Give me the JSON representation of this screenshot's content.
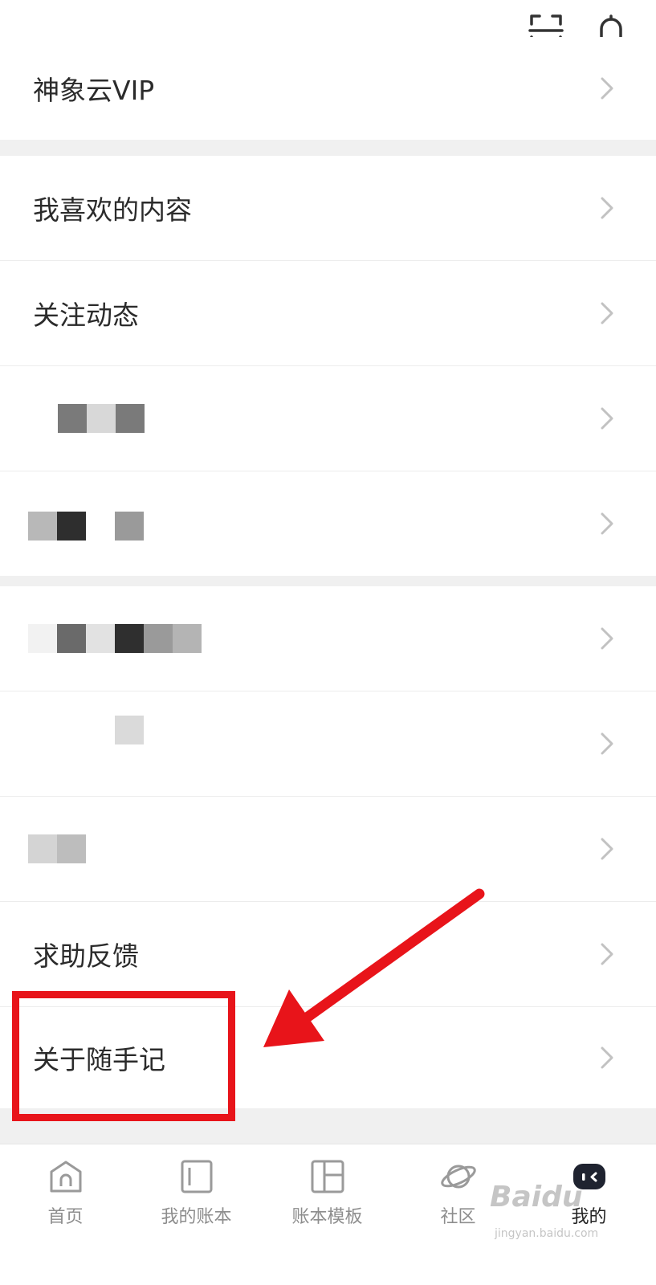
{
  "menu": {
    "vip": "神象云VIP",
    "liked": "我喜欢的内容",
    "follow": "关注动态",
    "help": "求助反馈",
    "about": "关于随手记"
  },
  "tabs": [
    {
      "label": "首页",
      "icon": "home-icon"
    },
    {
      "label": "我的账本",
      "icon": "ledger-icon"
    },
    {
      "label": "账本模板",
      "icon": "template-icon"
    },
    {
      "label": "社区",
      "icon": "planet-icon"
    },
    {
      "label": "我的",
      "icon": "mascot-icon"
    }
  ],
  "colors": {
    "annotation": "#e8141a",
    "background": "#f0f0f0",
    "text": "#2b2b2b",
    "tab_inactive": "#8d8d8d"
  },
  "watermark": {
    "main": "Baidu",
    "sub": "jingyan.baidu.com"
  }
}
